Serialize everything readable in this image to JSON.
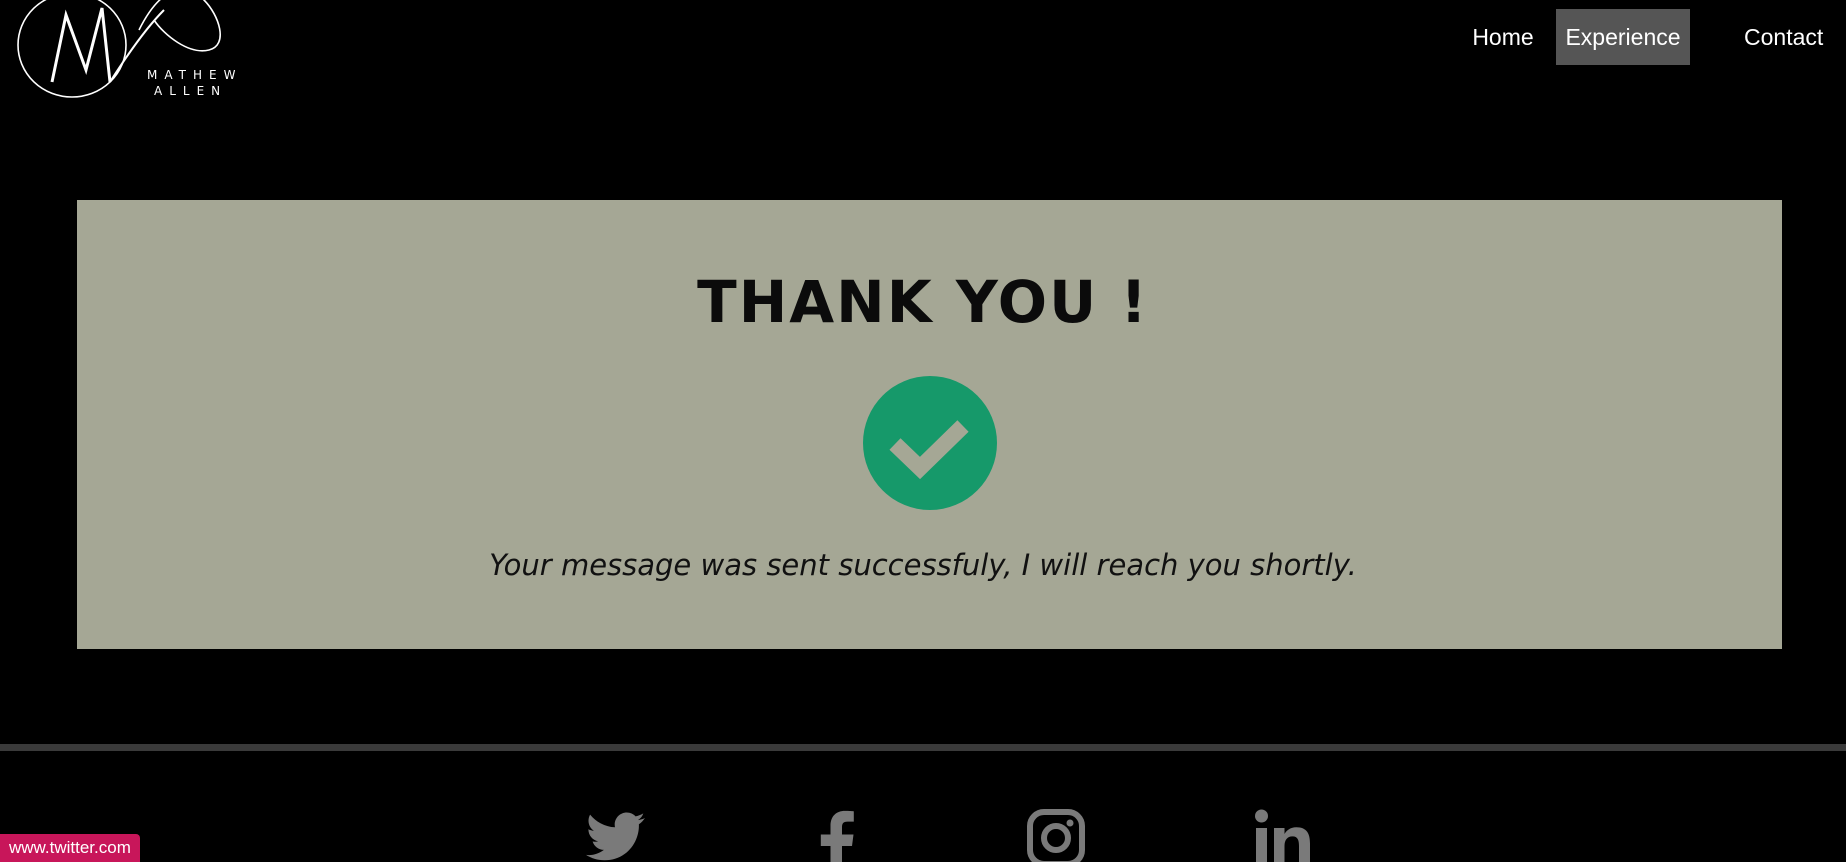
{
  "header": {
    "logo": {
      "monogram": "MA",
      "line1": "MATHEW",
      "line2": "ALLEN"
    },
    "nav": [
      {
        "label": "Home",
        "active": false
      },
      {
        "label": "Experience",
        "active": true
      },
      {
        "label": "Contact",
        "active": false
      }
    ]
  },
  "card": {
    "title": "THANK YOU !",
    "icon": "check-circle-icon",
    "message": "Your message was sent successfuly, I will reach you shortly."
  },
  "footer": {
    "social": [
      {
        "icon": "twitter-icon"
      },
      {
        "icon": "facebook-icon"
      },
      {
        "icon": "instagram-icon"
      },
      {
        "icon": "linkedin-icon"
      }
    ]
  },
  "status_bar": {
    "url": "www.twitter.com"
  },
  "colors": {
    "background": "#000000",
    "card": "#a5a795",
    "success": "#16996a",
    "nav_active": "#555555",
    "social_icon": "#7a7a7a",
    "status_url_bg": "#c8165a"
  }
}
